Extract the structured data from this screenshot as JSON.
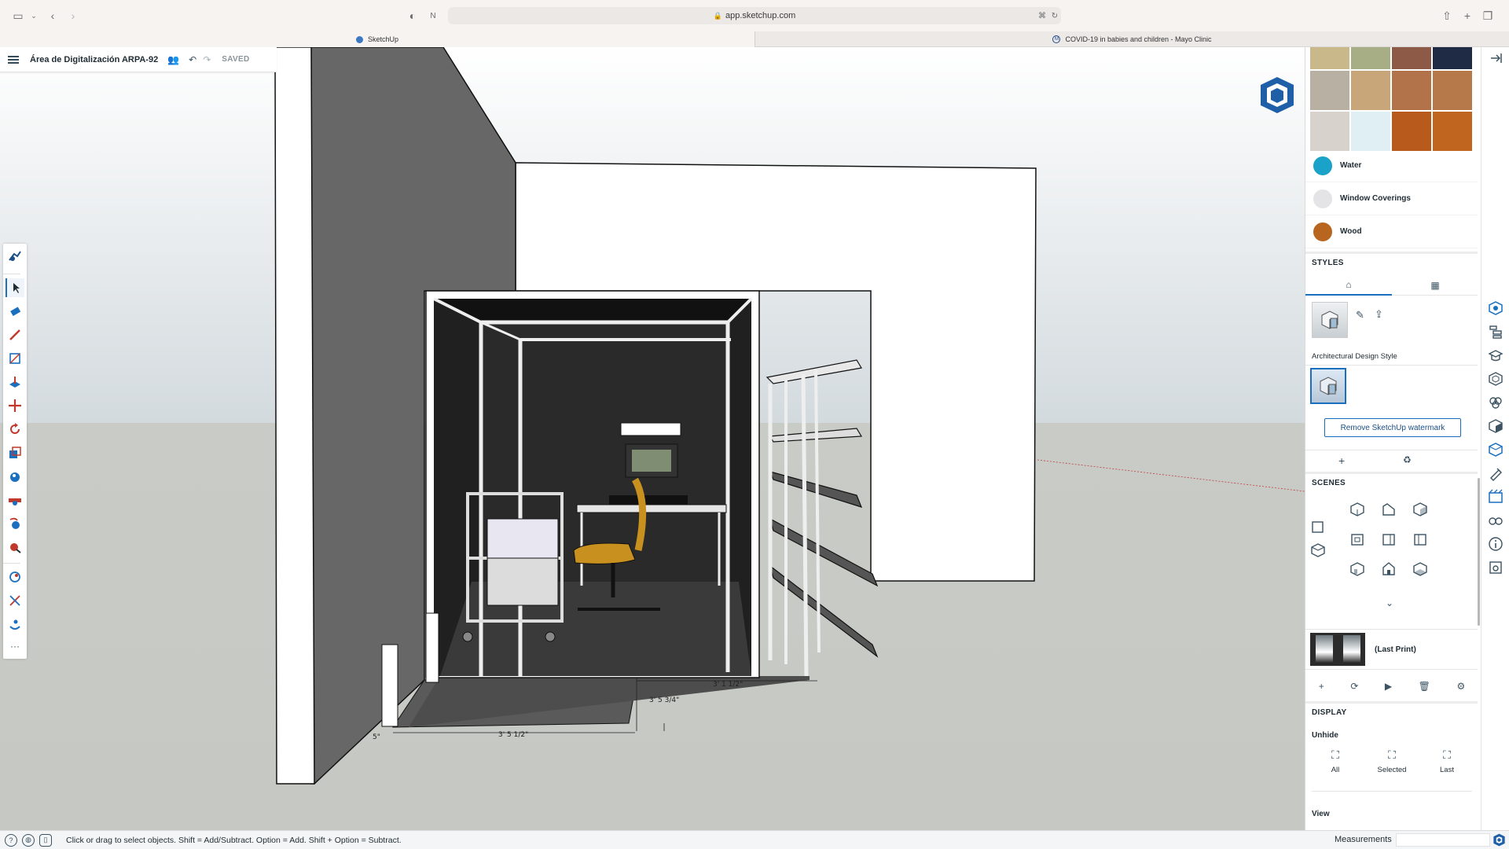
{
  "browser": {
    "url": "app.sketchup.com",
    "tabs": [
      {
        "label": "SketchUp",
        "active": true
      },
      {
        "label": "COVID-19 in babies and children - Mayo Clinic",
        "active": false
      }
    ]
  },
  "model": {
    "title": "Área de Digitalización ARPA-92",
    "save_state": "SAVED"
  },
  "dimensions": {
    "d1": "3' 1 1/2\"",
    "d2": "3' 5 3/4\"",
    "d3": "3' 5 1/2\"",
    "d4": "5\""
  },
  "materials": {
    "swatch_colors": [
      "#c9b98a",
      "#a7ae86",
      "#8c5a46",
      "#1f2a44",
      "#b8b1a3",
      "#c9a57a",
      "#b3734a",
      "#b67a4a",
      "#d8d2cc",
      "#dfeff3",
      "#b85a1c",
      "#c0651f"
    ],
    "items": [
      {
        "label": "Water",
        "color": "#1aa2c8"
      },
      {
        "label": "Window Coverings",
        "color": "#e4e4e6"
      },
      {
        "label": "Wood",
        "color": "#b8651f"
      }
    ]
  },
  "styles": {
    "header": "STYLES",
    "current_style": "Architectural Design Style",
    "watermark_button": "Remove SketchUp watermark"
  },
  "scenes": {
    "header": "SCENES",
    "items": [
      {
        "name": "(Last Print)"
      }
    ]
  },
  "display": {
    "header": "DISPLAY",
    "unhide_label": "Unhide",
    "unhide_buttons": [
      "All",
      "Selected",
      "Last"
    ],
    "view_label": "View"
  },
  "status": {
    "hint": "Click or drag to select objects. Shift = Add/Subtract. Option = Add. Shift + Option = Subtract.",
    "measurements_label": "Measurements",
    "measurements_value": ""
  },
  "colors": {
    "accent": "#1b6fbf",
    "brand": "#1e5fa8"
  },
  "icons": {
    "toolbar": [
      "search-tool-icon",
      "select-icon",
      "eraser-icon",
      "pencil-icon",
      "rectangle-icon",
      "push-pull-icon",
      "move-icon",
      "rotate-icon",
      "scale-icon",
      "paint-bucket-icon",
      "tape-measure-icon",
      "orbit-icon",
      "zoom-icon",
      "section-plane-icon",
      "axes-icon",
      "walk-icon",
      "more-icon"
    ]
  }
}
